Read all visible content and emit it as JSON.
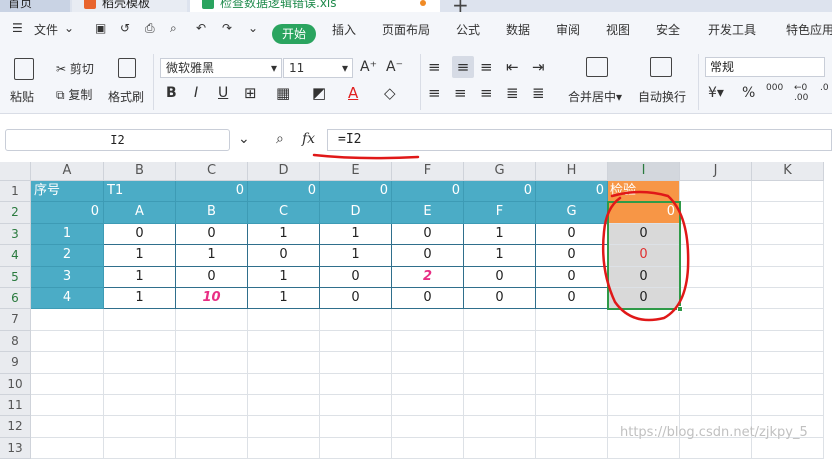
{
  "tabs": {
    "home": "首页",
    "template": "稻壳模板",
    "file": "检查数据逻辑错误.xls"
  },
  "menu": {
    "file": "文件",
    "start": "开始",
    "insert": "插入",
    "layout": "页面布局",
    "formula": "公式",
    "data": "数据",
    "review": "审阅",
    "view": "视图",
    "security": "安全",
    "dev": "开发工具",
    "special": "特色应用"
  },
  "ribbon": {
    "paste": "粘贴",
    "cut": "剪切",
    "copy": "复制",
    "format_painter": "格式刷",
    "font_name": "微软雅黑",
    "font_size": "11",
    "bold": "B",
    "italic": "I",
    "underline": "U",
    "merge": "合并居中",
    "wrap": "自动换行",
    "number_format": "常规"
  },
  "formula_bar": {
    "cell_ref": "I2",
    "formula": "=I2",
    "fx": "fx"
  },
  "columns": [
    "A",
    "B",
    "C",
    "D",
    "E",
    "F",
    "G",
    "H",
    "I",
    "J",
    "K"
  ],
  "rows": [
    "1",
    "2",
    "3",
    "4",
    "5",
    "6",
    "7",
    "8",
    "9",
    "10",
    "11",
    "12",
    "13"
  ],
  "sheet": {
    "r1": [
      "序号",
      "T1",
      "0",
      "0",
      "0",
      "0",
      "0",
      "0",
      "检验"
    ],
    "r2": [
      "0",
      "A",
      "B",
      "C",
      "D",
      "E",
      "F",
      "G",
      "0"
    ],
    "r3": [
      "1",
      "0",
      "0",
      "1",
      "1",
      "0",
      "1",
      "0",
      "0"
    ],
    "r4": [
      "2",
      "1",
      "1",
      "0",
      "1",
      "0",
      "1",
      "0",
      "0"
    ],
    "r5": [
      "3",
      "1",
      "0",
      "1",
      "0",
      "2",
      "0",
      "0",
      "0"
    ],
    "r6": [
      "4",
      "1",
      "10",
      "1",
      "0",
      "0",
      "0",
      "0",
      "0"
    ]
  },
  "watermark": "https://blog.csdn.net/zjkpy_5"
}
